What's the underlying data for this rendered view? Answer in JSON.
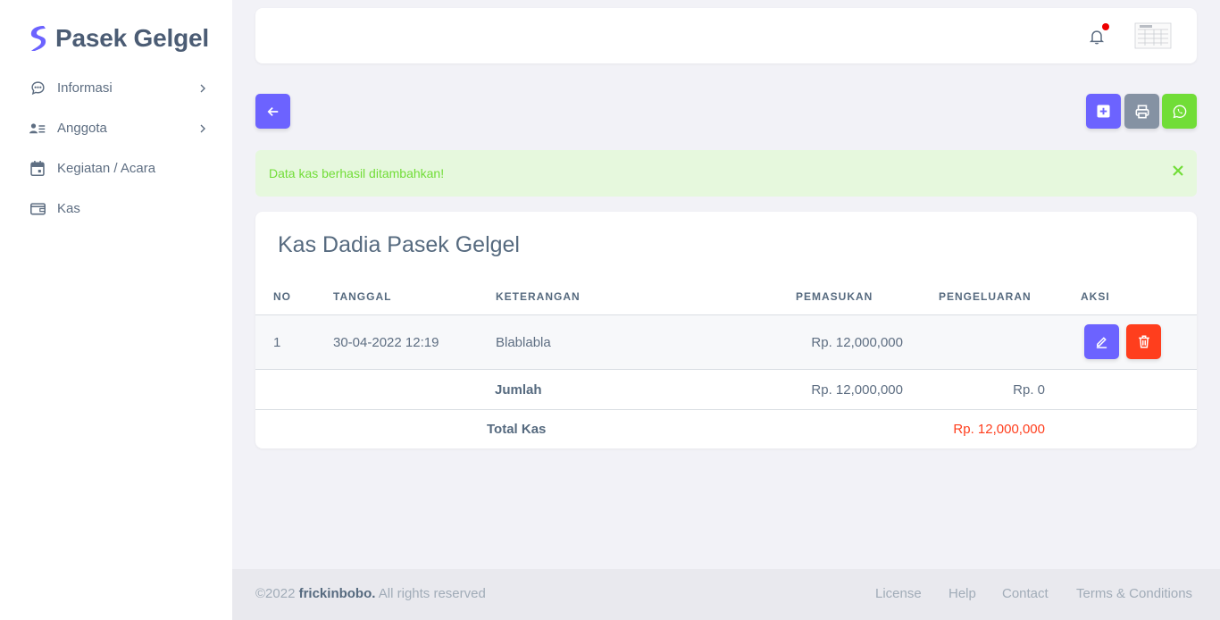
{
  "brand": {
    "name": "Pasek Gelgel",
    "accent": "#6c63ff"
  },
  "sidebar": {
    "items": [
      {
        "label": "Informasi",
        "icon": "chat-icon",
        "has_submenu": true
      },
      {
        "label": "Anggota",
        "icon": "users-list-icon",
        "has_submenu": true
      },
      {
        "label": "Kegiatan / Acara",
        "icon": "calendar-icon",
        "has_submenu": false
      },
      {
        "label": "Kas",
        "icon": "wallet-icon",
        "has_submenu": false
      }
    ]
  },
  "topbar": {
    "notification_icon": "bell-icon",
    "has_unread": true
  },
  "toolbar": {
    "back_icon": "arrow-left-icon",
    "add_icon": "plus-square-icon",
    "print_icon": "printer-icon",
    "whatsapp_icon": "whatsapp-icon"
  },
  "alert": {
    "message": "Data kas berhasil ditambahkan!",
    "color": "#71dd37"
  },
  "card": {
    "title": "Kas Dadia Pasek Gelgel",
    "columns": [
      "NO",
      "TANGGAL",
      "KETERANGAN",
      "PEMASUKAN",
      "PENGELUARAN",
      "AKSI"
    ],
    "rows": [
      {
        "no": "1",
        "tanggal": "30-04-2022 12:19",
        "keterangan": "Blablabla",
        "pemasukan": "Rp. 12,000,000",
        "pengeluaran": ""
      }
    ],
    "summary": {
      "jumlah_label": "Jumlah",
      "jumlah_pemasukan": "Rp. 12,000,000",
      "jumlah_pengeluaran": "Rp. 0",
      "total_label": "Total Kas",
      "total_value": "Rp. 12,000,000"
    }
  },
  "footer": {
    "copyright_prefix": "©2022 ",
    "author": "frickinbobo.",
    "copyright_suffix": " All rights reserved",
    "links": [
      "License",
      "Help",
      "Contact",
      "Terms & Conditions"
    ]
  }
}
